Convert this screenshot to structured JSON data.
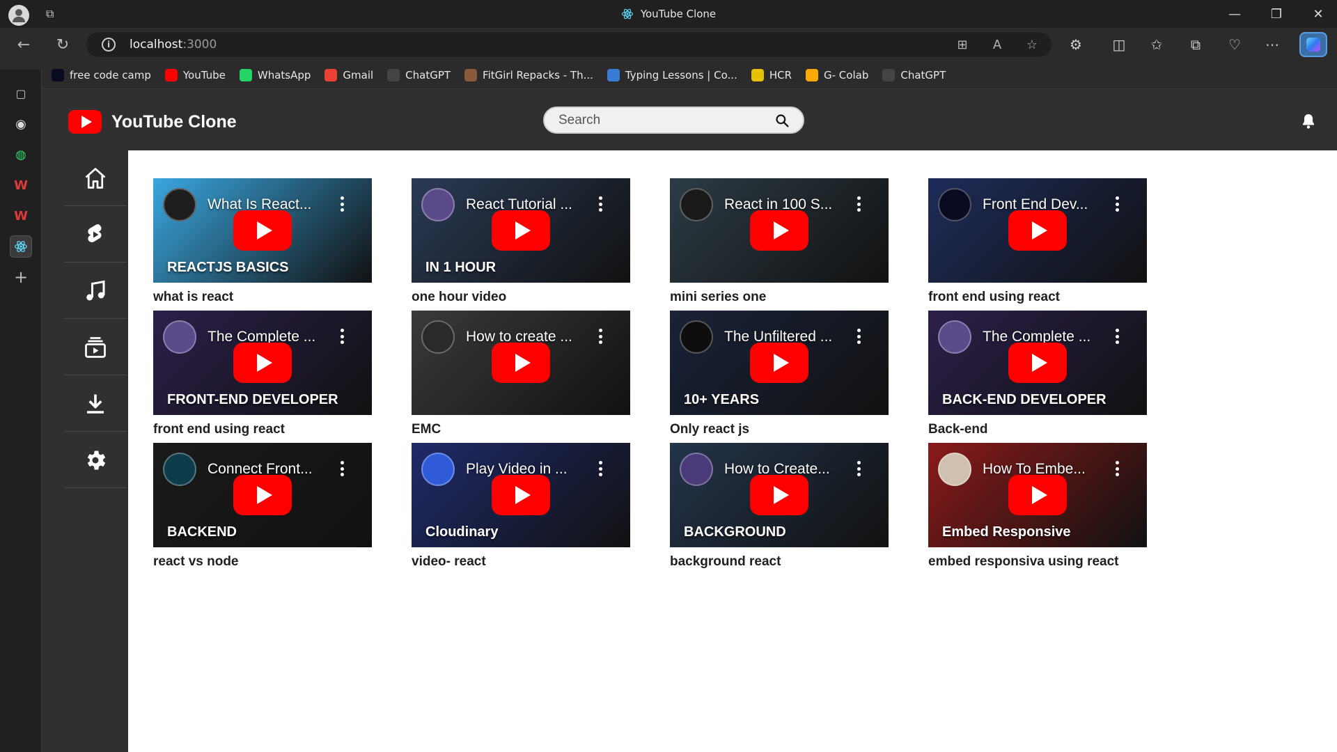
{
  "browser": {
    "window_title": "YouTube Clone",
    "url_host": "localhost",
    "url_port": ":3000"
  },
  "bookmarks": [
    {
      "label": "free code camp",
      "icon": "freecodecamp-icon",
      "color": "#0a0a23"
    },
    {
      "label": "YouTube",
      "icon": "youtube-icon",
      "color": "#ff0000"
    },
    {
      "label": "WhatsApp",
      "icon": "whatsapp-icon",
      "color": "#25d366"
    },
    {
      "label": "Gmail",
      "icon": "gmail-icon",
      "color": "#ea4335"
    },
    {
      "label": "ChatGPT",
      "icon": "chatgpt-icon",
      "color": "#444444"
    },
    {
      "label": "FitGirl Repacks - Th...",
      "icon": "fitgirl-icon",
      "color": "#8a5a3c"
    },
    {
      "label": "Typing Lessons | Co...",
      "icon": "typing-icon",
      "color": "#3a7bd5"
    },
    {
      "label": "HCR",
      "icon": "hcr-icon",
      "color": "#e5c100"
    },
    {
      "label": "G- Colab",
      "icon": "colab-icon",
      "color": "#f9ab00"
    },
    {
      "label": "ChatGPT",
      "icon": "chatgpt-icon",
      "color": "#444444"
    }
  ],
  "app": {
    "brand": "YouTube Clone",
    "search_placeholder": "Search",
    "sidebar": [
      {
        "name": "home",
        "icon": "home-icon"
      },
      {
        "name": "shorts",
        "icon": "shorts-icon"
      },
      {
        "name": "music",
        "icon": "music-note-icon"
      },
      {
        "name": "subscriptions",
        "icon": "subscriptions-icon"
      },
      {
        "name": "downloads",
        "icon": "download-icon"
      },
      {
        "name": "settings",
        "icon": "settings-icon"
      }
    ]
  },
  "videos": [
    {
      "thumb_title": "What Is React...",
      "label": "what is react",
      "overlay": "REACTJS BASICS",
      "bg": "#3aa7e0",
      "avatar_color": "#1e1e1e"
    },
    {
      "thumb_title": "React Tutorial ...",
      "label": "one hour video",
      "overlay": "IN 1 HOUR",
      "bg": "#2a3a55",
      "avatar_color": "#5a4a8a"
    },
    {
      "thumb_title": "React in 100 S...",
      "label": "mini series one",
      "overlay": "",
      "bg": "#2c3b45",
      "avatar_color": "#1a1a1a"
    },
    {
      "thumb_title": "Front End Dev...",
      "label": "front end using react",
      "overlay": "",
      "bg": "#1e2c5a",
      "avatar_color": "#0a0a23"
    },
    {
      "thumb_title": "The Complete ...",
      "label": "front end using react",
      "overlay": "FRONT-END DEVELOPER",
      "bg": "#2b1f4a",
      "avatar_color": "#5a4a8a"
    },
    {
      "thumb_title": "How to create ...",
      "label": "EMC",
      "overlay": "",
      "bg": "#3a3a3a",
      "avatar_color": "#2a2a2a"
    },
    {
      "thumb_title": "The Unfiltered ...",
      "label": "Only react js",
      "overlay": "10+ YEARS",
      "bg": "#1a2238",
      "avatar_color": "#0e0e0e"
    },
    {
      "thumb_title": "The Complete ...",
      "label": "Back-end",
      "overlay": "BACK-END DEVELOPER",
      "bg": "#2b1f4a",
      "avatar_color": "#5a4a8a"
    },
    {
      "thumb_title": "Connect Front...",
      "label": "react vs node",
      "overlay": "BACKEND",
      "bg": "#1a1a1a",
      "avatar_color": "#0d3b4a"
    },
    {
      "thumb_title": "Play Video in ...",
      "label": "video- react",
      "overlay": "Cloudinary",
      "bg": "#1f2a6a",
      "avatar_color": "#2f5bd8"
    },
    {
      "thumb_title": "How to Create...",
      "label": "background react",
      "overlay": "BACKGROUND",
      "bg": "#23344a",
      "avatar_color": "#4a3a7a"
    },
    {
      "thumb_title": "How To Embe...",
      "label": "embed responsiva using react",
      "overlay": "Embed Responsive",
      "bg": "#8a1a1a",
      "avatar_color": "#d0c0b0"
    }
  ]
}
